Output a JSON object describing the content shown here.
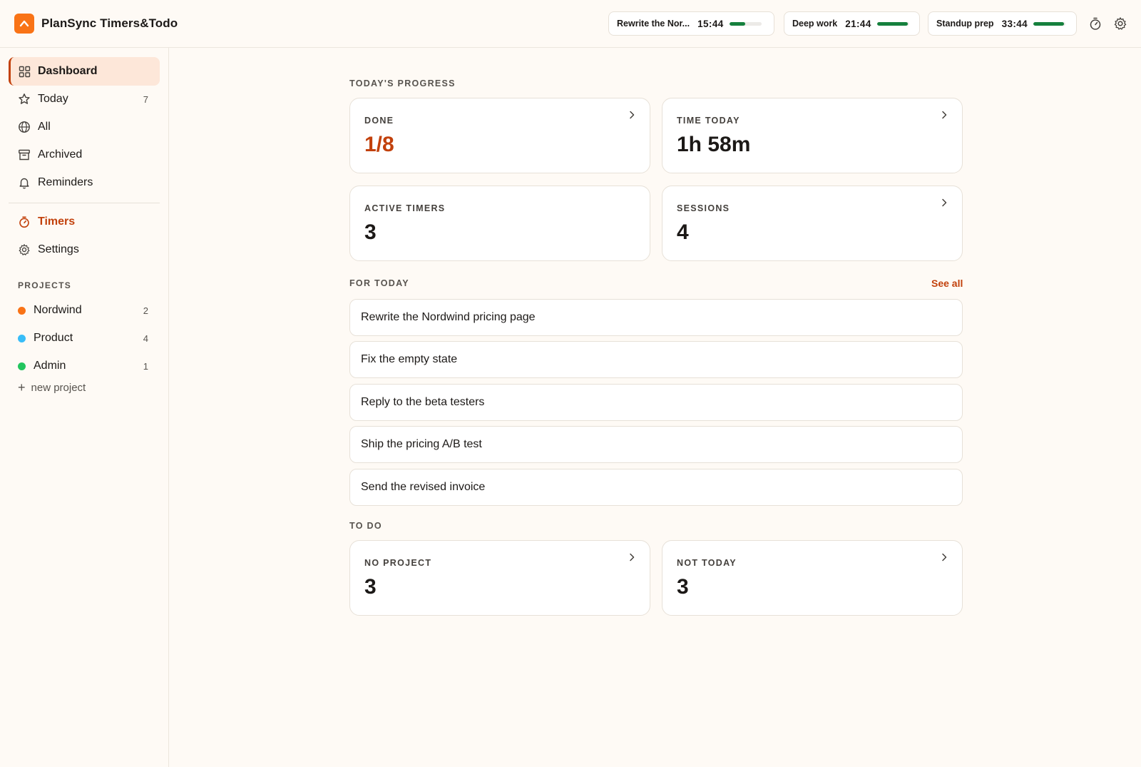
{
  "app": {
    "title": "PlanSync Timers&Todo"
  },
  "header": {
    "timers": [
      {
        "label": "Rewrite the Nor...",
        "time": "15:44",
        "progress": 0.5
      },
      {
        "label": "Deep work",
        "time": "21:44",
        "progress": 0.95
      },
      {
        "label": "Standup prep",
        "time": "33:44",
        "progress": 0.95
      }
    ],
    "icons": [
      "stopwatch-icon",
      "gear-icon"
    ]
  },
  "sidebar": {
    "nav": [
      {
        "label": "Dashboard",
        "icon": "grid-icon",
        "count": ""
      },
      {
        "label": "Today",
        "icon": "star-icon",
        "count": "7"
      },
      {
        "label": "All",
        "icon": "globe-icon",
        "count": ""
      },
      {
        "label": "Archived",
        "icon": "archive-icon",
        "count": ""
      },
      {
        "label": "Reminders",
        "icon": "bell-icon",
        "count": ""
      }
    ],
    "tools": [
      {
        "label": "Timers",
        "icon": "stopwatch-icon"
      },
      {
        "label": "Settings",
        "icon": "gear-icon"
      }
    ],
    "projects_label": "PROJECTS",
    "projects": [
      {
        "label": "Nordwind",
        "count": "2",
        "color": "#f97316"
      },
      {
        "label": "Product",
        "count": "4",
        "color": "#38bdf8"
      },
      {
        "label": "Admin",
        "count": "1",
        "color": "#22c55e"
      }
    ],
    "new_project": "new project"
  },
  "main": {
    "progress_label": "TODAY'S PROGRESS",
    "stats": [
      {
        "label": "DONE",
        "value": "1/8"
      },
      {
        "label": "TIME TODAY",
        "value": "1h 58m"
      },
      {
        "label": "ACTIVE TIMERS",
        "value": "3"
      },
      {
        "label": "SESSIONS",
        "value": "4"
      }
    ],
    "for_today_label": "FOR TODAY",
    "see_all": "See all",
    "tasks": [
      "Rewrite the Nordwind pricing page",
      "Fix the empty state",
      "Reply to the beta testers",
      "Ship the pricing A/B test",
      "Send the revised invoice"
    ],
    "todo_label": "TO DO",
    "todo_stats": [
      {
        "label": "NO PROJECT",
        "value": "3"
      },
      {
        "label": "NOT TODAY",
        "value": "3"
      }
    ]
  },
  "colors": {
    "accent": "#c2410c",
    "brand": "#f97316",
    "background": "#fefaf5",
    "timer_bar": "#15803d"
  }
}
